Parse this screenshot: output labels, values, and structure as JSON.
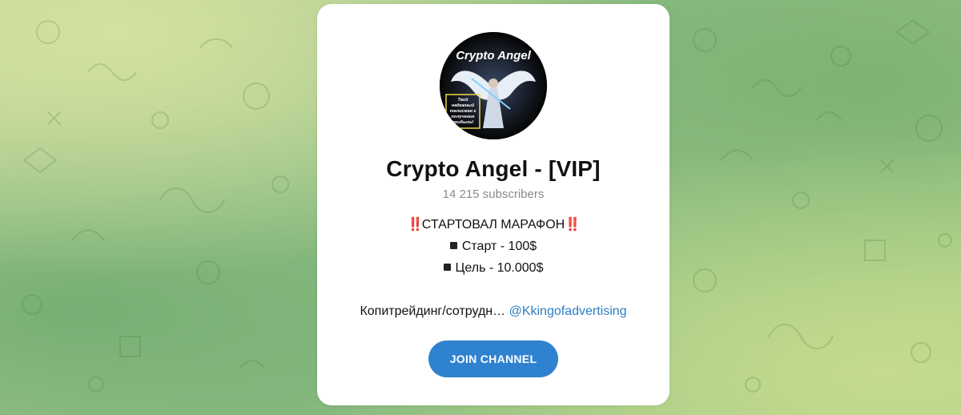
{
  "channel": {
    "avatar_text": "Crypto Angel",
    "avatar_tagline": [
      "Твой",
      "надежный",
      "талисман к",
      "получение",
      "прибыли!"
    ],
    "title": "Crypto Angel - [VIP]",
    "subscribers": "14 215 subscribers",
    "description": {
      "line1_prefix": "‼️",
      "line1_text": "СТАРТОВАЛ МАРАФОН",
      "line1_suffix": "‼️",
      "line2": "Старт - 100$",
      "line3": "Цель - 10.000$",
      "line5_text": "Копитрейдинг/сотрудн… ",
      "line5_link": "@Kkingofadvertising"
    },
    "join_label": "JOIN CHANNEL"
  },
  "colors": {
    "accent": "#2f82cf",
    "link": "#2e7dc1",
    "card_bg": "#ffffff"
  }
}
